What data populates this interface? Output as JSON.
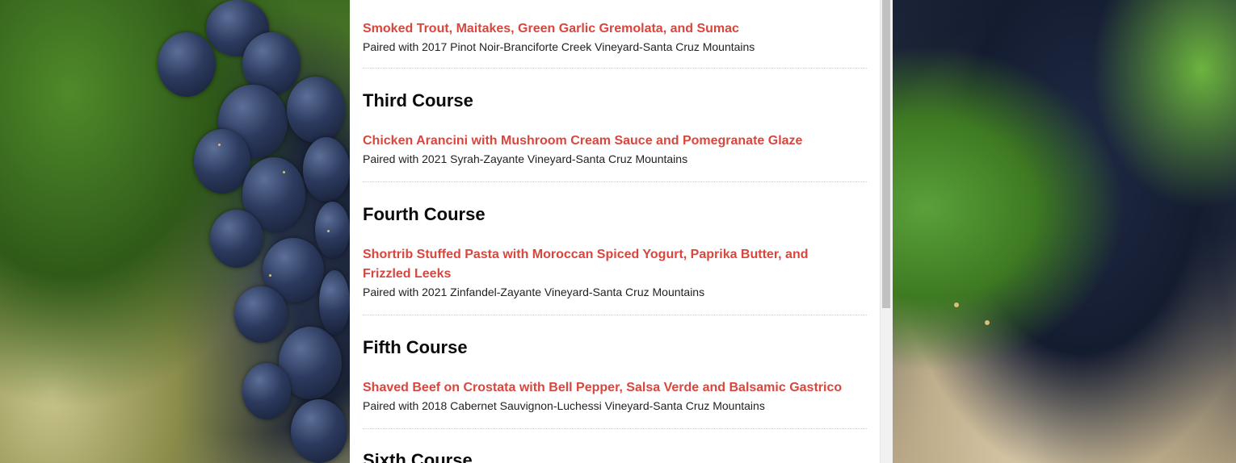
{
  "colors": {
    "accent": "#d9463e",
    "text": "#222222",
    "heading": "#0a0a0a",
    "panel": "#ffffff"
  },
  "menu": {
    "partial_item": {
      "dish": "Smoked Trout, Maitakes, Green Garlic Gremolata, and Sumac",
      "pairing": "Paired with 2017 Pinot Noir-Branciforte Creek Vineyard-Santa Cruz Mountains"
    },
    "courses": [
      {
        "name": "Third Course",
        "dish": "Chicken Arancini with Mushroom Cream Sauce and Pomegranate Glaze",
        "pairing": "Paired with 2021 Syrah-Zayante Vineyard-Santa Cruz Mountains"
      },
      {
        "name": "Fourth Course",
        "dish": "Shortrib Stuffed Pasta with Moroccan Spiced Yogurt, Paprika Butter, and Frizzled Leeks",
        "pairing": "Paired with 2021 Zinfandel-Zayante Vineyard-Santa Cruz Mountains"
      },
      {
        "name": "Fifth Course",
        "dish": "Shaved Beef on Crostata with Bell Pepper, Salsa Verde and Balsamic Gastrico",
        "pairing": "Paired with 2018 Cabernet Sauvignon-Luchessi Vineyard-Santa Cruz Mountains"
      },
      {
        "name": "Sixth Course"
      }
    ]
  }
}
